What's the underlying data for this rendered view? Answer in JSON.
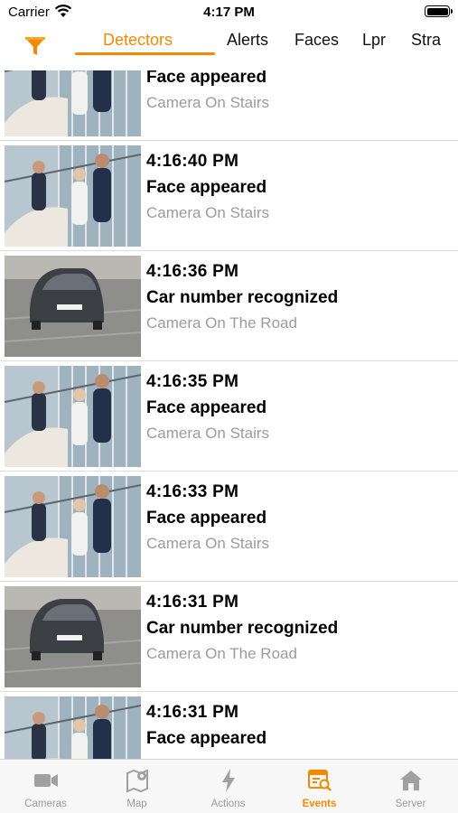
{
  "status_bar": {
    "carrier": "Carrier",
    "time": "4:17 PM"
  },
  "top_tabs": {
    "items": [
      {
        "label": "Detectors",
        "active": true
      },
      {
        "label": "Alerts"
      },
      {
        "label": "Faces"
      },
      {
        "label": "Lpr"
      },
      {
        "label": "Stra"
      }
    ]
  },
  "events": [
    {
      "time": "",
      "title": "Face appeared",
      "camera": "Camera On Stairs",
      "thumb": "stairs"
    },
    {
      "time": "4:16:40 PM",
      "title": "Face appeared",
      "camera": "Camera On Stairs",
      "thumb": "stairs"
    },
    {
      "time": "4:16:36 PM",
      "title": "Car number recognized",
      "camera": "Camera On The Road",
      "thumb": "road"
    },
    {
      "time": "4:16:35 PM",
      "title": "Face appeared",
      "camera": "Camera On Stairs",
      "thumb": "stairs"
    },
    {
      "time": "4:16:33 PM",
      "title": "Face appeared",
      "camera": "Camera On Stairs",
      "thumb": "stairs"
    },
    {
      "time": "4:16:31 PM",
      "title": "Car number recognized",
      "camera": "Camera On The Road",
      "thumb": "road"
    },
    {
      "time": "4:16:31 PM",
      "title": "Face appeared",
      "camera": "",
      "thumb": "stairs"
    }
  ],
  "tab_bar": {
    "items": [
      {
        "label": "Cameras",
        "icon": "video-camera-icon"
      },
      {
        "label": "Map",
        "icon": "map-pin-icon"
      },
      {
        "label": "Actions",
        "icon": "lightning-icon"
      },
      {
        "label": "Events",
        "icon": "events-search-icon",
        "active": true
      },
      {
        "label": "Server",
        "icon": "house-icon"
      }
    ]
  },
  "colors": {
    "accent": "#f28a00",
    "inactive": "#9a9a9a",
    "secondary_text": "#9b9b9b"
  }
}
